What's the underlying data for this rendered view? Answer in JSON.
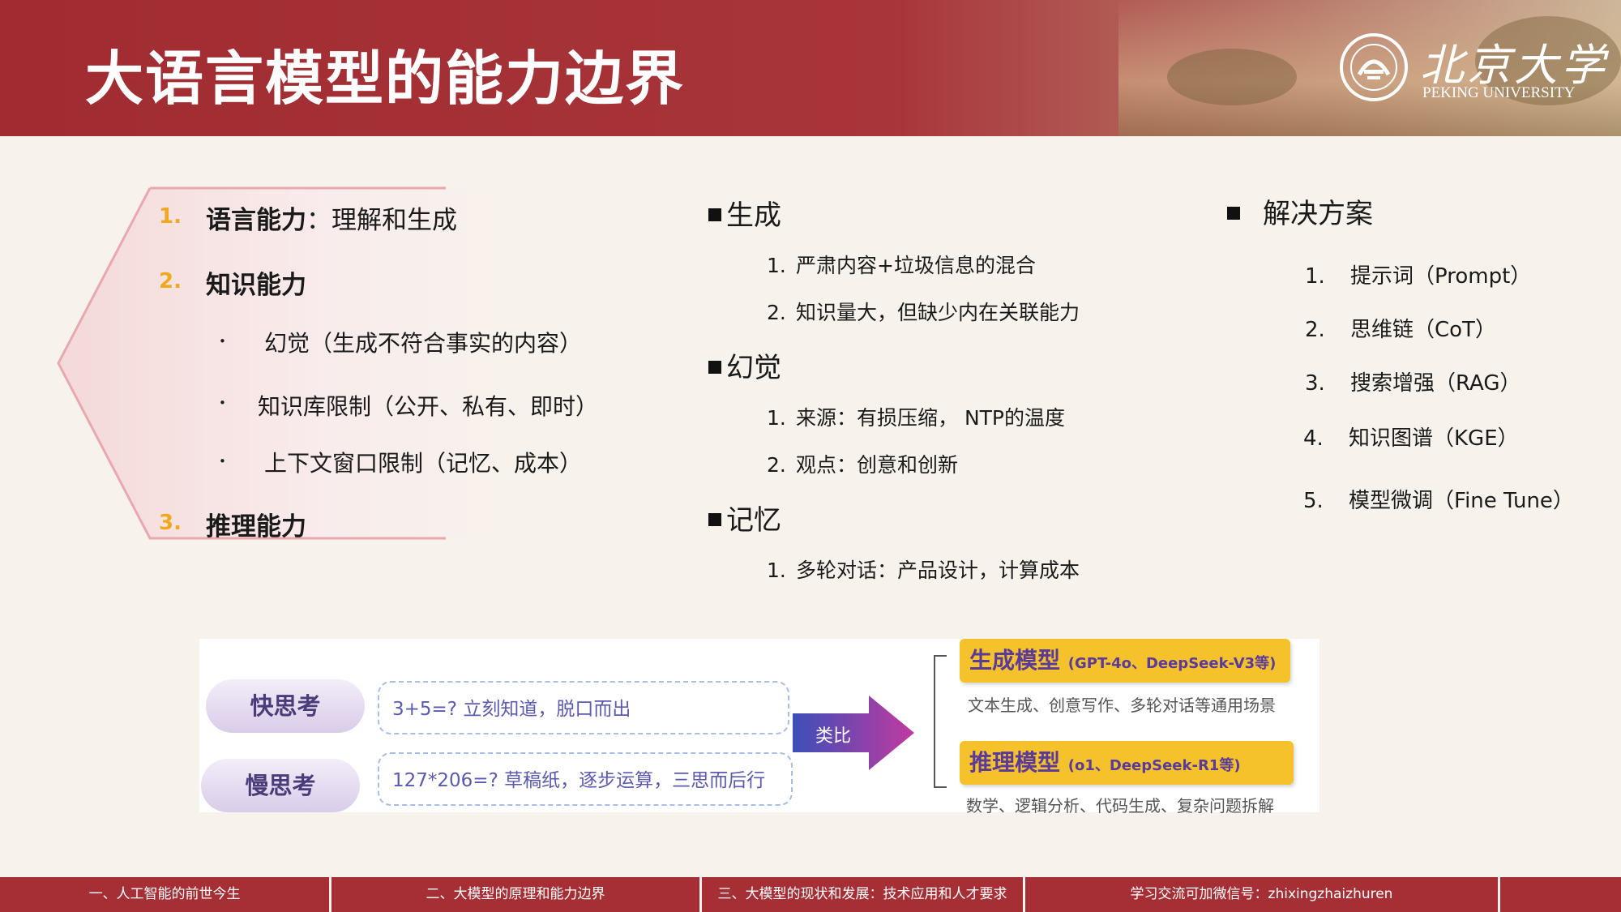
{
  "header": {
    "title": "大语言模型的能力边界",
    "logo_cn": "北京大学",
    "logo_en": "PEKING UNIVERSITY"
  },
  "left": {
    "items": [
      {
        "num": "1.",
        "title": "语言能力",
        "sub": "：理解和生成"
      },
      {
        "num": "2.",
        "title": "知识能力",
        "sub": ""
      },
      {
        "num": "3.",
        "title": "推理能力",
        "sub": ""
      }
    ],
    "bullets": [
      "幻觉（生成不符合事实的内容）",
      "知识库限制（公开、私有、即时）",
      "上下文窗口限制（记忆、成本）"
    ],
    "bullet_mark": "•"
  },
  "middle": {
    "sections": [
      {
        "title": "生成",
        "items": [
          "严肃内容+垃圾信息的混合",
          "知识量大，但缺少内在关联能力"
        ]
      },
      {
        "title": "幻觉",
        "items": [
          "来源：有损压缩，  NTP的温度",
          "观点：创意和创新"
        ]
      },
      {
        "title": "记忆",
        "items": [
          "多轮对话：产品设计，计算成本"
        ]
      }
    ]
  },
  "right": {
    "title": "解决方案",
    "items": [
      "提示词（Prompt）",
      "思维链（CoT）",
      "搜索增强（RAG）",
      "知识图谱（KGE）",
      "模型微调（Fine Tune）"
    ]
  },
  "figure": {
    "fast_label": "快思考",
    "slow_label": "慢思考",
    "fast_text": "3+5=?  立刻知道，脱口而出",
    "slow_text": "127*206=?  草稿纸，逐步运算，三思而后行",
    "arrow_label": "类比",
    "gen_model": "生成模型",
    "gen_model_ex": "(GPT-4o、DeepSeek-V3等)",
    "gen_desc": "文本生成、创意写作、多轮对话等通用场景",
    "reason_model": "推理模型",
    "reason_model_ex": "(o1、DeepSeek-R1等)",
    "reason_desc": "数学、逻辑分析、代码生成、复杂问题拆解"
  },
  "footer": {
    "items": [
      "一、人工智能的前世今生",
      "二、大模型的原理和能力边界",
      "三、大模型的现状和发展：技术应用和人才要求",
      "学习交流可加微信号：zhixingzhaizhuren"
    ]
  },
  "colors": {
    "brand_red": "#a52f35",
    "accent_orange": "#f0a91e",
    "label_yellow": "#f6c22c",
    "arrow_purple": "#9b3aa8",
    "background": "#f7f3ec"
  },
  "icons": {
    "logo": "peking-university-seal-icon",
    "square": "square-bullet-icon",
    "arrow": "right-arrow-icon"
  }
}
